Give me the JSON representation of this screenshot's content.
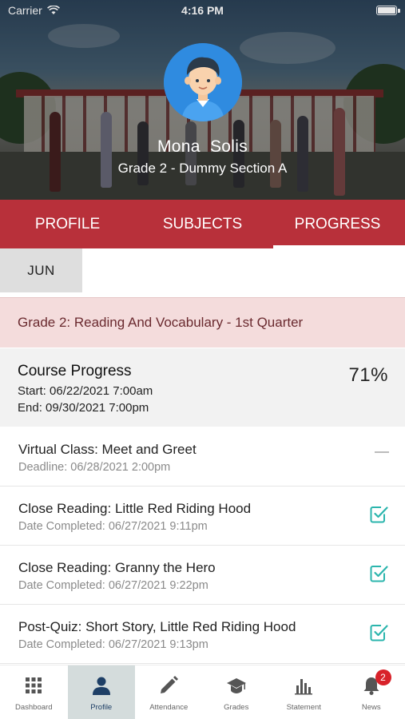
{
  "status_bar": {
    "carrier": "Carrier",
    "time": "4:16 PM"
  },
  "profile": {
    "name": "Mona  Solis",
    "section": "Grade 2 - Dummy Section A"
  },
  "tabs": [
    {
      "label": "PROFILE",
      "active": false
    },
    {
      "label": "SUBJECTS",
      "active": false
    },
    {
      "label": "PROGRESS",
      "active": true
    }
  ],
  "month_selector": {
    "selected": "JUN"
  },
  "course": {
    "title": "Grade 2: Reading And Vocabulary - 1st Quarter",
    "progress_label": "Course Progress",
    "start": "Start: 06/22/2021 7:00am",
    "end": "End: 09/30/2021 7:00pm",
    "percent": "71%"
  },
  "activities": [
    {
      "title": "Virtual Class: Meet and Greet",
      "detail": "Deadline: 06/28/2021 2:00pm",
      "status": "pending"
    },
    {
      "title": "Close Reading: Little Red Riding Hood",
      "detail": "Date Completed: 06/27/2021 9:11pm",
      "status": "completed"
    },
    {
      "title": "Close Reading: Granny the Hero",
      "detail": "Date Completed: 06/27/2021 9:22pm",
      "status": "completed"
    },
    {
      "title": "Post-Quiz: Short Story, Little Red Riding Hood",
      "detail": "Date Completed: 06/27/2021 9:13pm",
      "status": "completed"
    }
  ],
  "bottom_nav": [
    {
      "label": "Dashboard",
      "icon": "grid-icon",
      "active": false
    },
    {
      "label": "Profile",
      "icon": "person-icon",
      "active": true
    },
    {
      "label": "Attendance",
      "icon": "pencil-icon",
      "active": false
    },
    {
      "label": "Grades",
      "icon": "graduation-cap-icon",
      "active": false
    },
    {
      "label": "Statement",
      "icon": "bar-chart-icon",
      "active": false
    },
    {
      "label": "News",
      "icon": "bell-icon",
      "active": false,
      "badge": "2"
    }
  ],
  "colors": {
    "brand_red": "#b8303a",
    "course_header_bg": "#f4dcdc",
    "check_teal": "#2bb5ad",
    "active_nav_bg": "#d4dcdc",
    "badge_red": "#d8222a"
  }
}
